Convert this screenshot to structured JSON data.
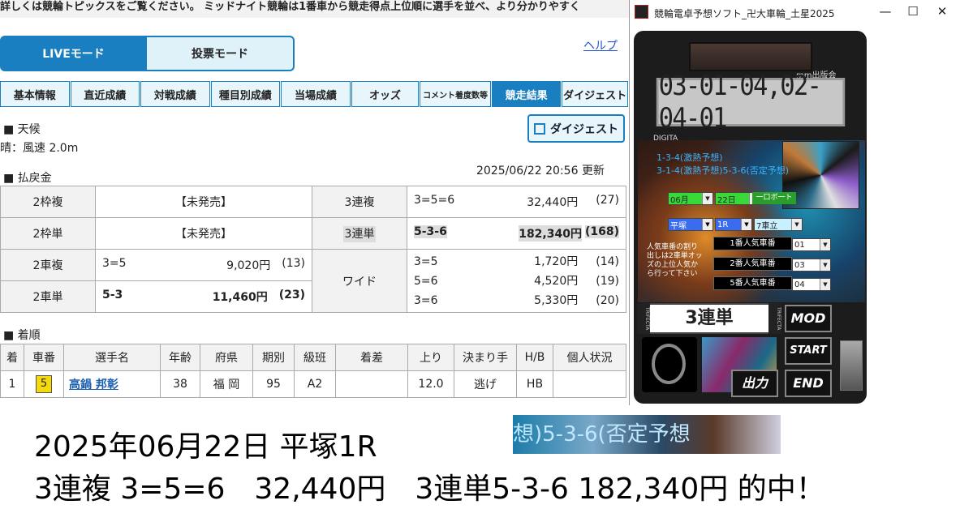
{
  "ticker": "詳しくは競輪トピックスをご覧ください。 ミッドナイト競輪は1番車から競走得点上位順に選手を並べ、より分かりやすく",
  "modes": {
    "live": "LIVEモード",
    "vote": "投票モード"
  },
  "help": "ヘルプ",
  "tabs": [
    "基本情報",
    "直近成績",
    "対戦成績",
    "種目別成績",
    "当場成績",
    "オッズ",
    "コメント着度数等",
    "競走結果",
    "ダイジェスト"
  ],
  "weather": {
    "heading": "■ 天候",
    "value": "晴：風速 2.0m"
  },
  "digest_button": "ダイジェスト",
  "payout": {
    "heading": "■ 払戻金",
    "updated": "2025/06/22 20:56 更新",
    "waku_fuku": {
      "label": "2枠複",
      "value": "【未発売】"
    },
    "waku_tan": {
      "label": "2枠単",
      "value": "【未発売】"
    },
    "sanfuku": {
      "label": "3連複",
      "combo": "3=5=6",
      "amount": "32,440円",
      "pop": "(27)"
    },
    "santan": {
      "label": "3連単",
      "combo": "5-3-6",
      "amount": "182,340円",
      "pop": "(168)"
    },
    "nishafuku": {
      "label": "2車複",
      "combo": "3=5",
      "amount": "9,020円",
      "pop": "(13)"
    },
    "nishatan": {
      "label": "2車単",
      "combo": "5-3",
      "amount": "11,460円",
      "pop": "(23)"
    },
    "wide": {
      "label": "ワイド",
      "rows": [
        {
          "combo": "3=5",
          "amount": "1,720円",
          "pop": "(14)"
        },
        {
          "combo": "5=6",
          "amount": "4,520円",
          "pop": "(19)"
        },
        {
          "combo": "3=6",
          "amount": "5,330円",
          "pop": "(20)"
        }
      ]
    }
  },
  "finish": {
    "heading": "■ 着順",
    "headers": [
      "着",
      "車番",
      "選手名",
      "年齢",
      "府県",
      "期別",
      "級班",
      "着差",
      "上り",
      "決まり手",
      "H/B",
      "個人状況"
    ],
    "rows": [
      {
        "pos": "1",
        "car": "5",
        "name": "高鍋 邦彰",
        "age": "38",
        "pref": "福 岡",
        "term": "95",
        "class": "A2",
        "margin": "",
        "last": "12.0",
        "kimari": "逃げ",
        "hb": "HB",
        "status": ""
      }
    ]
  },
  "app": {
    "title": "競輪電卓予想ソフト_卍大車輪_土星2025",
    "brand": "mm出版会",
    "lcd": "03-01-04,02-04-01",
    "digita": "DIGITA",
    "predictions": [
      "1-3-4(激熱予想)",
      "3-1-4(激熱予想)5-3-6(否定予想)"
    ],
    "month": "06月",
    "day": "22日",
    "ichiko": "一口ボ一ト",
    "venue": "平塚",
    "race": "1R",
    "bet_type": "7車立",
    "note": "人気車番の割り出しは2車単オッズの上位人気から行って下さい",
    "popular": [
      {
        "label": "1番人気車番",
        "value": "01"
      },
      {
        "label": "2番人気車番",
        "value": "03"
      },
      {
        "label": "5番人気車番",
        "value": "04"
      }
    ],
    "trifecta_side": "TRIFECTA",
    "display": "3連単",
    "buttons": {
      "mod": "MOD",
      "start": "START",
      "output": "出力",
      "end": "END"
    }
  },
  "overlay": {
    "strip": "想)5-3-6(否定予想",
    "line1": "2025年06月22日 平塚1R",
    "line2": "3連複 3=5=6　32,440円　3連単5-3-6 182,340円 的中！"
  }
}
